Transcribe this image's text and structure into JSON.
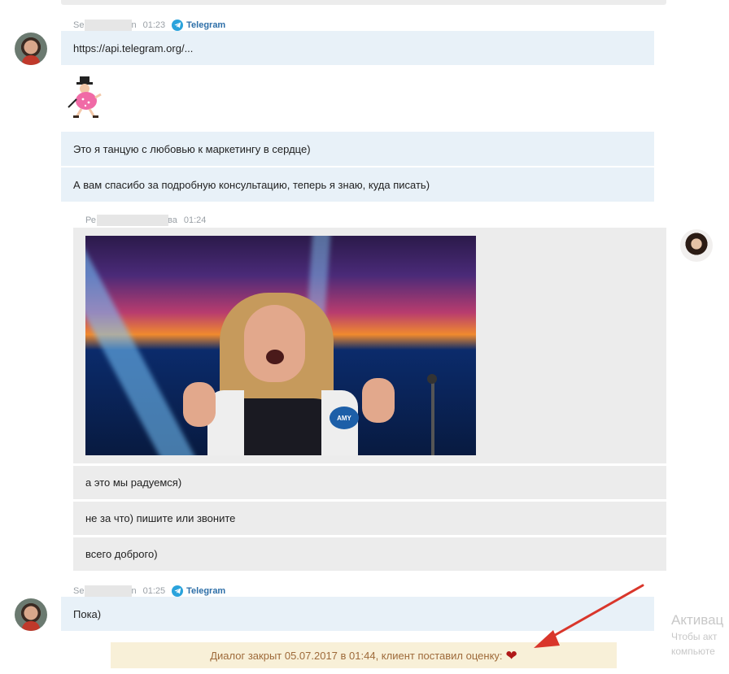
{
  "colors": {
    "client_bubble": "#e8f1f8",
    "agent_bubble": "#ececec",
    "telegram_accent": "#2e6fa8",
    "closed_bar_bg": "#f8f0d8",
    "closed_bar_text": "#9e6a3a",
    "heart": "#b01818",
    "arrow": "#d9362b"
  },
  "messages": {
    "client_group_1": {
      "sender_visible": "Se",
      "sender_tail": "n",
      "time": "01:23",
      "channel": "Telegram",
      "channel_icon": "telegram-icon",
      "link": "https://api.telegram.org/...",
      "sticker_icon": "dancing-sticker-icon",
      "text_1": "Это я танцую с любовью к маркетингу в сердце)",
      "text_2": "А вам спасибо за подробную консультацию, теперь я знаю, куда писать)"
    },
    "agent_group": {
      "sender_visible": "Ре",
      "sender_tail": "ва",
      "time": "01:24",
      "media_badge": "AMY",
      "text_1": "а это мы радуемся)",
      "text_2": "не за что) пишите или звоните",
      "text_3": "всего доброго)"
    },
    "client_group_2": {
      "sender_visible": "Se",
      "sender_tail": "n",
      "time": "01:25",
      "channel": "Telegram",
      "text_1": "Пока)"
    }
  },
  "status": {
    "closed_text": "Диалог закрыт 05.07.2017 в 01:44, клиент поставил оценку:",
    "rating_icon": "heart-icon",
    "rating_symbol": "❤"
  },
  "watermark": {
    "line1": "Активац",
    "line2": "Чтобы акт",
    "line3": "компьюте"
  }
}
